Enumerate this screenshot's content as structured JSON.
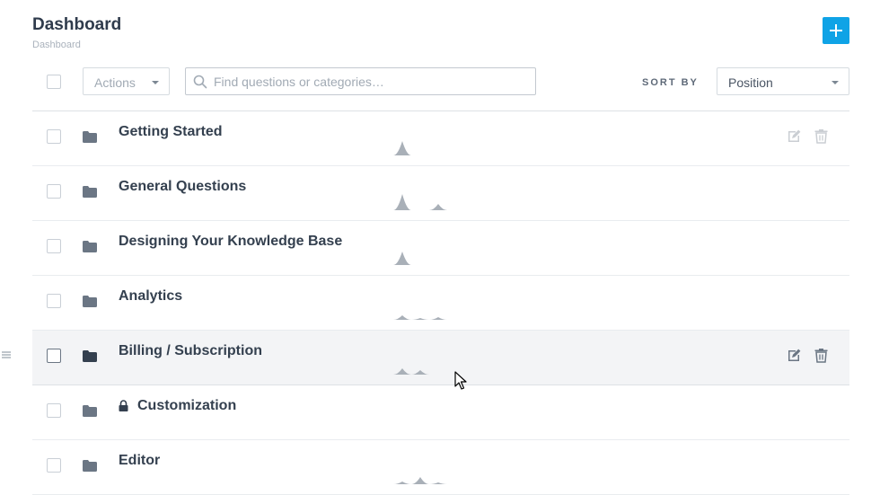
{
  "header": {
    "title": "Dashboard",
    "breadcrumb": "Dashboard",
    "add_button_icon": "plus-icon"
  },
  "toolbar": {
    "actions_label": "Actions",
    "search_placeholder": "Find questions or categories…",
    "search_value": "",
    "sort_by_label": "SORT BY",
    "sort_selected": "Position"
  },
  "colors": {
    "accent": "#0fa3e6",
    "text": "#34404f",
    "sparkline": "#a9b0b8",
    "folder": "#6b7684",
    "folder_active": "#34404f"
  },
  "categories": [
    {
      "name": "Getting Started",
      "locked": false,
      "spark": [
        0.0,
        0.8,
        0.0,
        0.0
      ]
    },
    {
      "name": "General Questions",
      "locked": false,
      "spark": [
        0.0,
        0.9,
        0.0,
        0.35
      ]
    },
    {
      "name": "Designing Your Knowledge Base",
      "locked": false,
      "spark": [
        0.0,
        0.75,
        0.0,
        0.0
      ]
    },
    {
      "name": "Analytics",
      "locked": false,
      "spark": [
        0.0,
        0.25,
        0.1,
        0.15
      ]
    },
    {
      "name": "Billing / Subscription",
      "locked": false,
      "spark": [
        0.0,
        0.35,
        0.25,
        0.0
      ]
    },
    {
      "name": "Customization",
      "locked": true,
      "spark": null
    },
    {
      "name": "Editor",
      "locked": false,
      "spark": [
        0.0,
        0.15,
        0.4,
        0.1
      ]
    }
  ]
}
